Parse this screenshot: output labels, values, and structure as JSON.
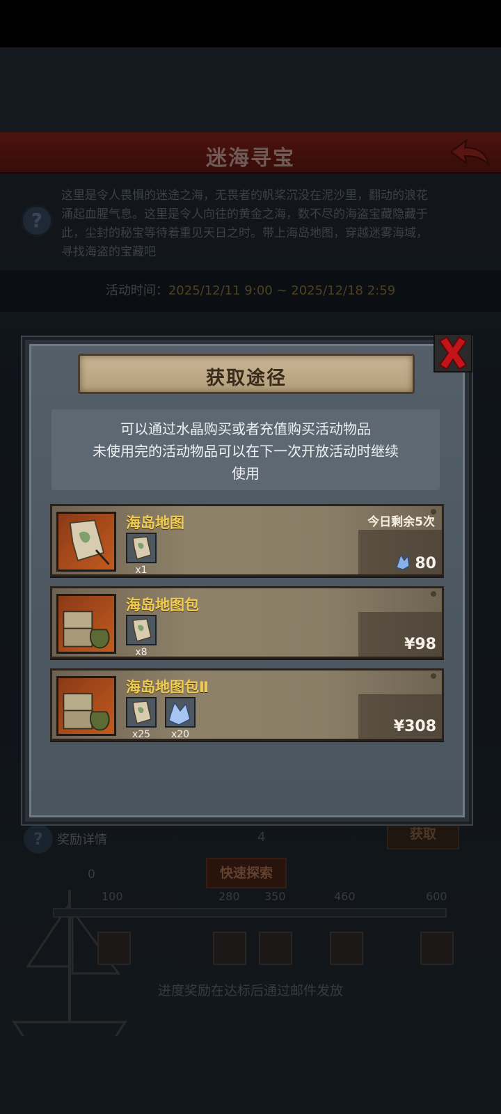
{
  "background": {
    "title": "迷海寻宝",
    "description": "这里是令人畏惧的迷途之海，无畏者的帆桨沉没在泥沙里，翻动的浪花涌起血腥气息。这里是令人向往的黄金之海，数不尽的海盗宝藏隐藏于此，尘封的秘宝等待着重见天日之时。带上海岛地图，穿越迷雾海域，寻找海盗的宝藏吧",
    "time_label": "活动时间：",
    "time_value": "2025/12/11 9:00 ~ 2025/12/18 2:59",
    "reward_label": "奖励详情",
    "map_count": "4",
    "get_button": "获取",
    "quick_explore_button": "快速探索",
    "progress_start": "0",
    "milestones": [
      "100",
      "280",
      "350",
      "460",
      "600"
    ],
    "footer": "进度奖励在达标后通过邮件发放"
  },
  "modal": {
    "title": "获取途径",
    "info_lines": [
      "可以通过水晶购买或者充值购买活动物品",
      "未使用完的活动物品可以在下一次开放活动时继续",
      "使用"
    ],
    "offers": [
      {
        "name": "海岛地图",
        "remaining": "今日剩余5次",
        "price_icon": "crystal-icon",
        "price": "80",
        "items": [
          {
            "icon": "island-map-icon",
            "qty": "x1"
          }
        ]
      },
      {
        "name": "海岛地图包",
        "price": "¥98",
        "items": [
          {
            "icon": "island-map-icon",
            "qty": "x8"
          }
        ]
      },
      {
        "name": "海岛地图包Ⅱ",
        "price": "¥308",
        "items": [
          {
            "icon": "island-map-icon",
            "qty": "x25"
          },
          {
            "icon": "crystal-icon",
            "qty": "x20"
          }
        ]
      }
    ]
  },
  "colors": {
    "header_red": "#6a1a14",
    "gold_text": "#f1cc52",
    "close_red": "#c2151a",
    "panel_bg": "#545f69"
  }
}
